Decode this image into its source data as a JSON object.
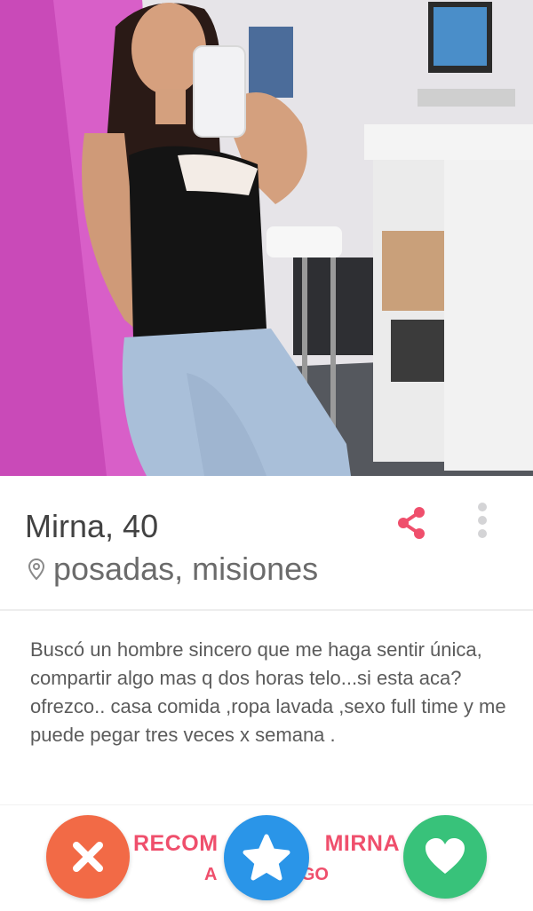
{
  "profile": {
    "name": "Mirna",
    "age": "40",
    "location": "posadas, misiones"
  },
  "bio": "Buscó un hombre sincero que me haga sentir única, compartir algo mas q dos horas telo...si esta aca?ofrezco.. casa comida ,ropa lavada ,sexo full time y me puede pegar tres veces x semana .",
  "recommend": {
    "line1_left": "RECOM",
    "line1_right": "MIRNA",
    "line2_left": "A",
    "line2_right": "GO"
  },
  "icons": {
    "share": "share-icon",
    "more": "more-vertical-icon",
    "location": "location-pin-icon",
    "nope": "close-icon",
    "superlike": "star-icon",
    "like": "heart-icon"
  },
  "colors": {
    "nope": "#f26a46",
    "superlike": "#2a95e8",
    "like": "#38c27a",
    "accent": "#ef4f6c"
  }
}
